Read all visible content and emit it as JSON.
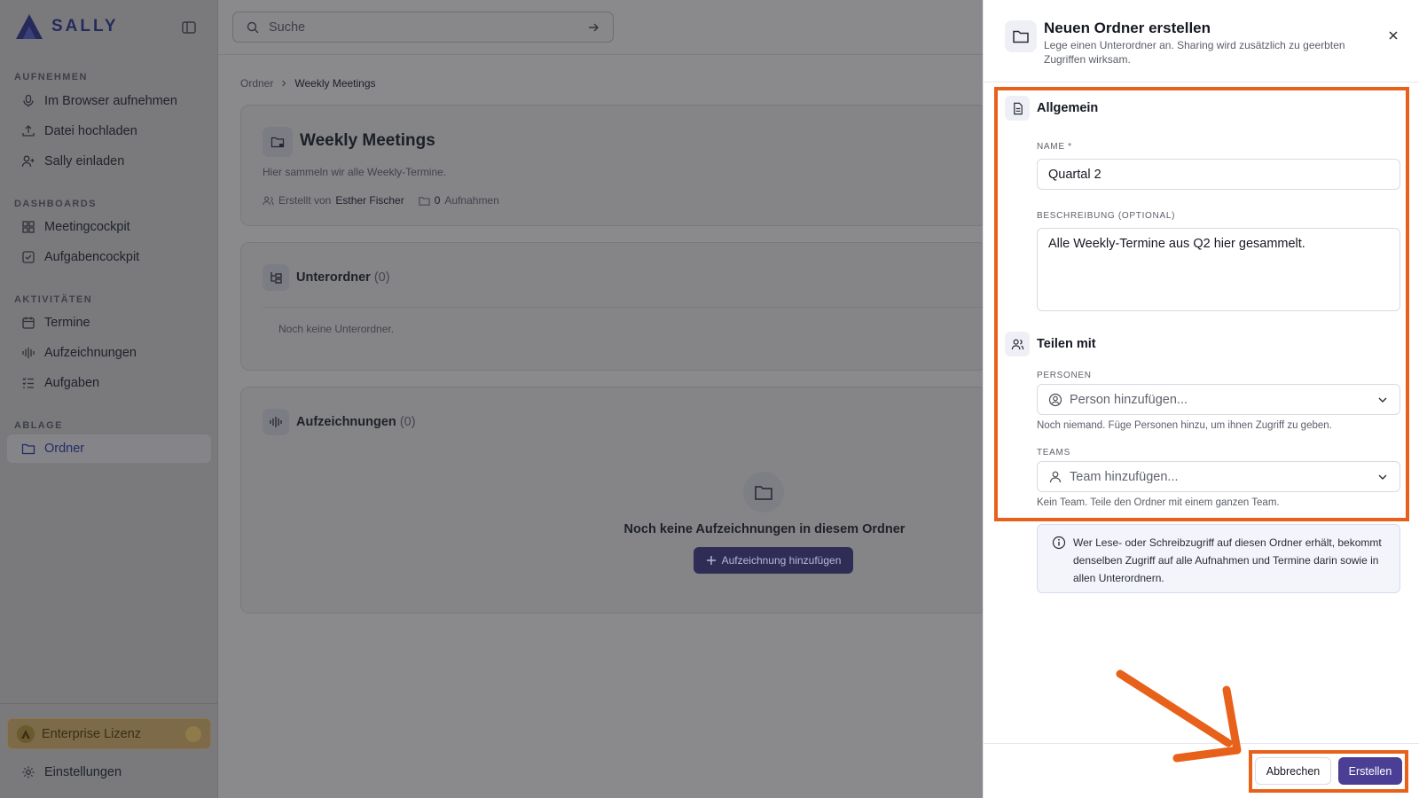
{
  "app": {
    "brand": "SALLY"
  },
  "sidebar": {
    "sections": {
      "record": "AUFNEHMEN",
      "dashboards": "DASHBOARDS",
      "activities": "AKTIVITÄTEN",
      "storage": "ABLAGE"
    },
    "items": {
      "browser_record": "Im Browser aufnehmen",
      "upload": "Datei hochladen",
      "invite": "Sally einladen",
      "meetingcockpit": "Meetingcockpit",
      "taskcockpit": "Aufgabencockpit",
      "appointments": "Termine",
      "recordings": "Aufzeichnungen",
      "tasks": "Aufgaben",
      "folders": "Ordner"
    },
    "license": "Enterprise Lizenz",
    "settings": "Einstellungen"
  },
  "search": {
    "placeholder": "Suche"
  },
  "breadcrumb": {
    "root": "Ordner",
    "current": "Weekly Meetings"
  },
  "folder": {
    "title": "Weekly Meetings",
    "description": "Hier sammeln wir alle Weekly-Termine.",
    "created_by_label": "Erstellt von",
    "created_by": "Esther Fischer",
    "recording_count": "0",
    "recording_label": "Aufnahmen"
  },
  "subfolders": {
    "title": "Unterordner",
    "count": "(0)",
    "empty": "Noch keine Unterordner."
  },
  "recordings_card": {
    "title": "Aufzeichnungen",
    "count": "(0)",
    "empty": "Noch keine Aufzeichnungen in diesem Ordner",
    "add_button": "Aufzeichnung hinzufügen"
  },
  "dialog": {
    "title": "Neuen Ordner erstellen",
    "subtitle": "Lege einen Unterordner an. Sharing wird zusätzlich zu geerbten Zugriffen wirksam.",
    "general": {
      "title": "Allgemein",
      "name_label": "NAME *",
      "name_value": "Quartal 2",
      "desc_label": "BESCHREIBUNG (OPTIONAL)",
      "desc_value": "Alle Weekly-Termine aus Q2 hier gesammelt."
    },
    "share": {
      "title": "Teilen mit",
      "persons_label": "PERSONEN",
      "persons_placeholder": "Person hinzufügen...",
      "persons_hint": "Noch niemand. Füge Personen hinzu, um ihnen Zugriff zu geben.",
      "teams_label": "TEAMS",
      "teams_placeholder": "Team hinzufügen...",
      "teams_hint": "Kein Team. Teile den Ordner mit einem ganzen Team."
    },
    "info": "Wer Lese- oder Schreibzugriff auf diesen Ordner erhält, bekommt denselben Zugriff auf alle Aufnahmen und Termine darin sowie in allen Unterordnern.",
    "cancel": "Abbrechen",
    "create": "Erstellen"
  },
  "colors": {
    "accent": "#4b3f95",
    "annotation": "#e8611a",
    "brand": "#262a5b"
  }
}
